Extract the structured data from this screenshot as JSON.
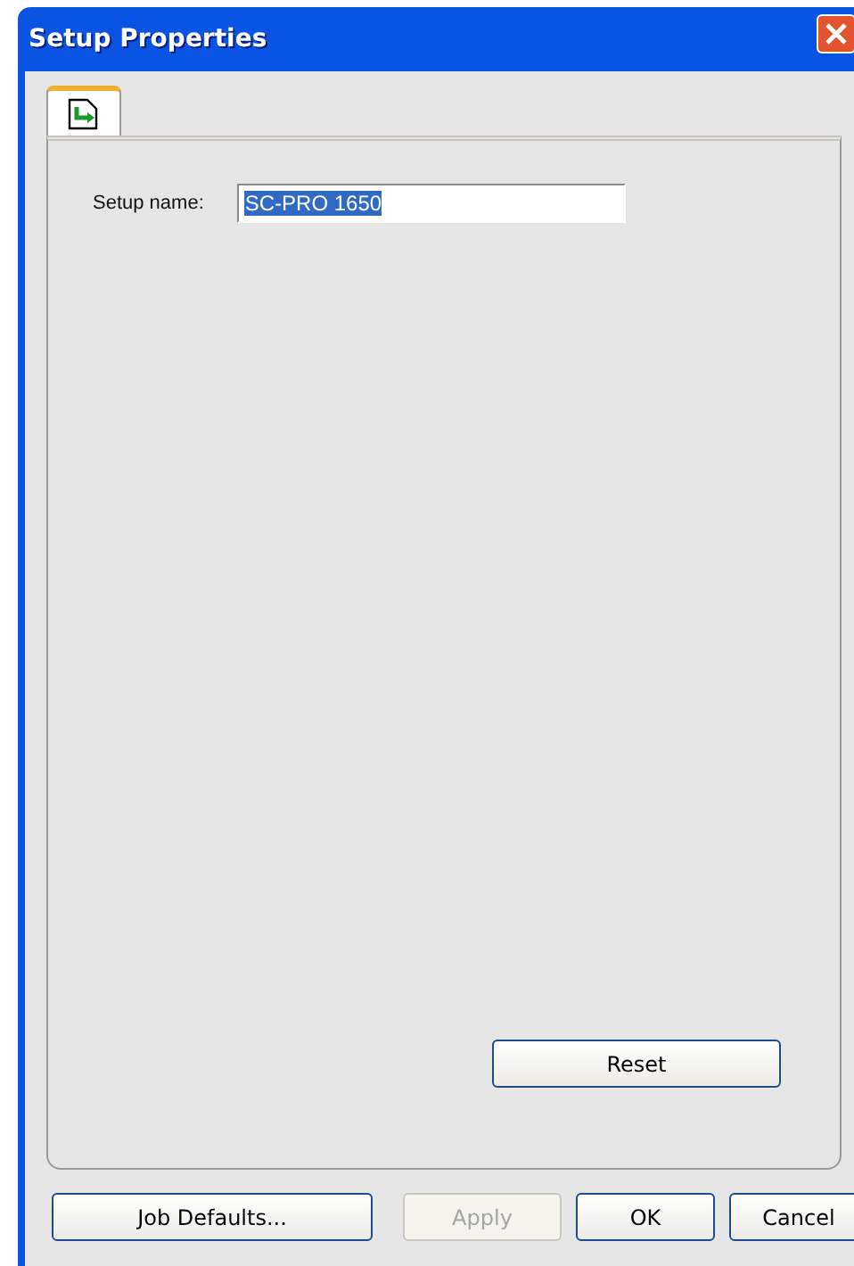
{
  "window": {
    "title": "Setup Properties"
  },
  "tabs": [
    {
      "selected": true
    }
  ],
  "setup_name": {
    "label": "Setup name:",
    "value": "SC-PRO 1650",
    "text_selected": true
  },
  "reset_button": {
    "label": "Reset",
    "disabled": false
  },
  "buttons": [
    {
      "label": "Job Defaults...",
      "disabled": false
    },
    {
      "label": "Apply",
      "disabled": true
    },
    {
      "label": "OK",
      "disabled": false
    },
    {
      "label": "Cancel",
      "disabled": false
    }
  ]
}
